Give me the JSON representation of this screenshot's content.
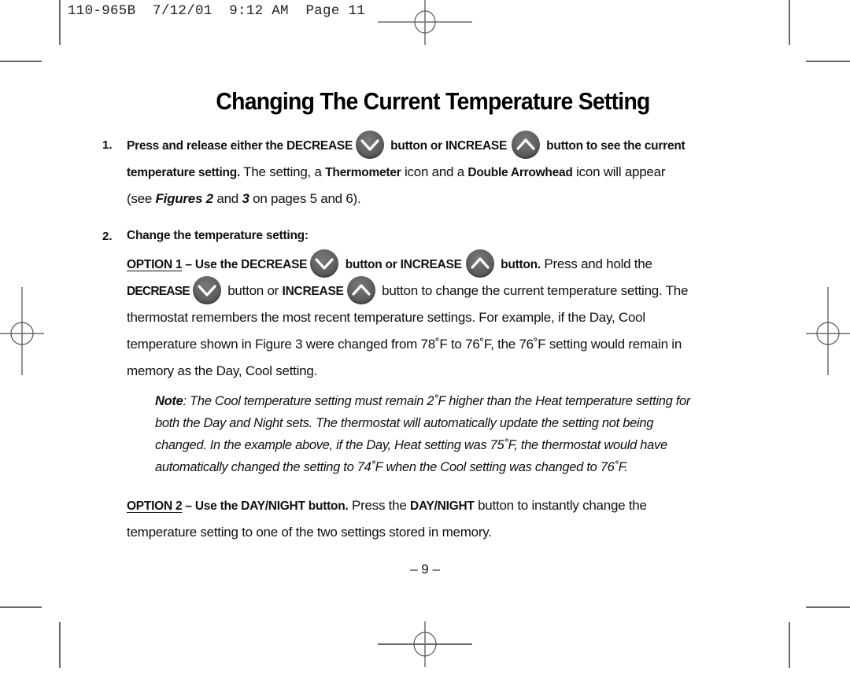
{
  "header": {
    "slug": "110-965B  7/12/01  9:12 AM  Page 11"
  },
  "title": "Changing The Current Temperature Setting",
  "icons": {
    "decrease": "chevron-down-circle-icon",
    "increase": "chevron-up-circle-icon",
    "registration": "crosshair-registration-mark"
  },
  "step1": {
    "number": "1.",
    "line1_a": "Press and release either the DECREASE",
    "line1_b": "button or INCREASE",
    "line1_c": "button to see the current",
    "line2_bold": "temperature setting.",
    "line2_a": " The setting, a ",
    "line2_thermo": "Thermometer",
    "line2_b": " icon and a ",
    "line2_arrow": "Double Arrowhead",
    "line2_c": " icon will appear",
    "line3_a": "(see ",
    "line3_fig": "Figures 2",
    "line3_b": " and ",
    "line3_three": "3",
    "line3_c": " on pages 5 and 6)."
  },
  "step2": {
    "number": "2.",
    "heading": "Change the temperature setting:",
    "option1_label": "OPTION 1",
    "option1_a": " – Use the DECREASE",
    "option1_b": "button or INCREASE",
    "option1_c": "button.",
    "option1_d": " Press and hold the",
    "line2_decrease": "DECREASE",
    "line2_a": "button or ",
    "line2_increase": "INCREASE",
    "line2_b": "button to change the current temperature setting. The",
    "line3": "thermostat remembers the most recent temperature settings. For example, if the Day, Cool",
    "line4": "temperature shown in Figure 3 were changed from 78˚F to 76˚F, the 76˚F setting would remain in",
    "line5": "memory as the Day, Cool setting.",
    "note_label": "Note",
    "note_line1": ": The Cool temperature setting must remain 2˚F higher than the Heat temperature setting for",
    "note_line2": "both the Day and Night sets. The thermostat will automatically update the setting not being",
    "note_line3": "changed. In the example above, if the Day, Heat setting was 75˚F, the thermostat would have",
    "note_line4": "automatically changed the setting to 74˚F when the Cool setting was changed to 76˚F.",
    "option2_label": "OPTION 2",
    "option2_a": " – Use the DAY/NIGHT button.",
    "option2_b": " Press the ",
    "option2_daynight": "DAY/NIGHT",
    "option2_c": " button to instantly change the",
    "option2_line2": "temperature setting to one of the two settings stored in memory."
  },
  "footer": {
    "page_number": "– 9 –"
  }
}
